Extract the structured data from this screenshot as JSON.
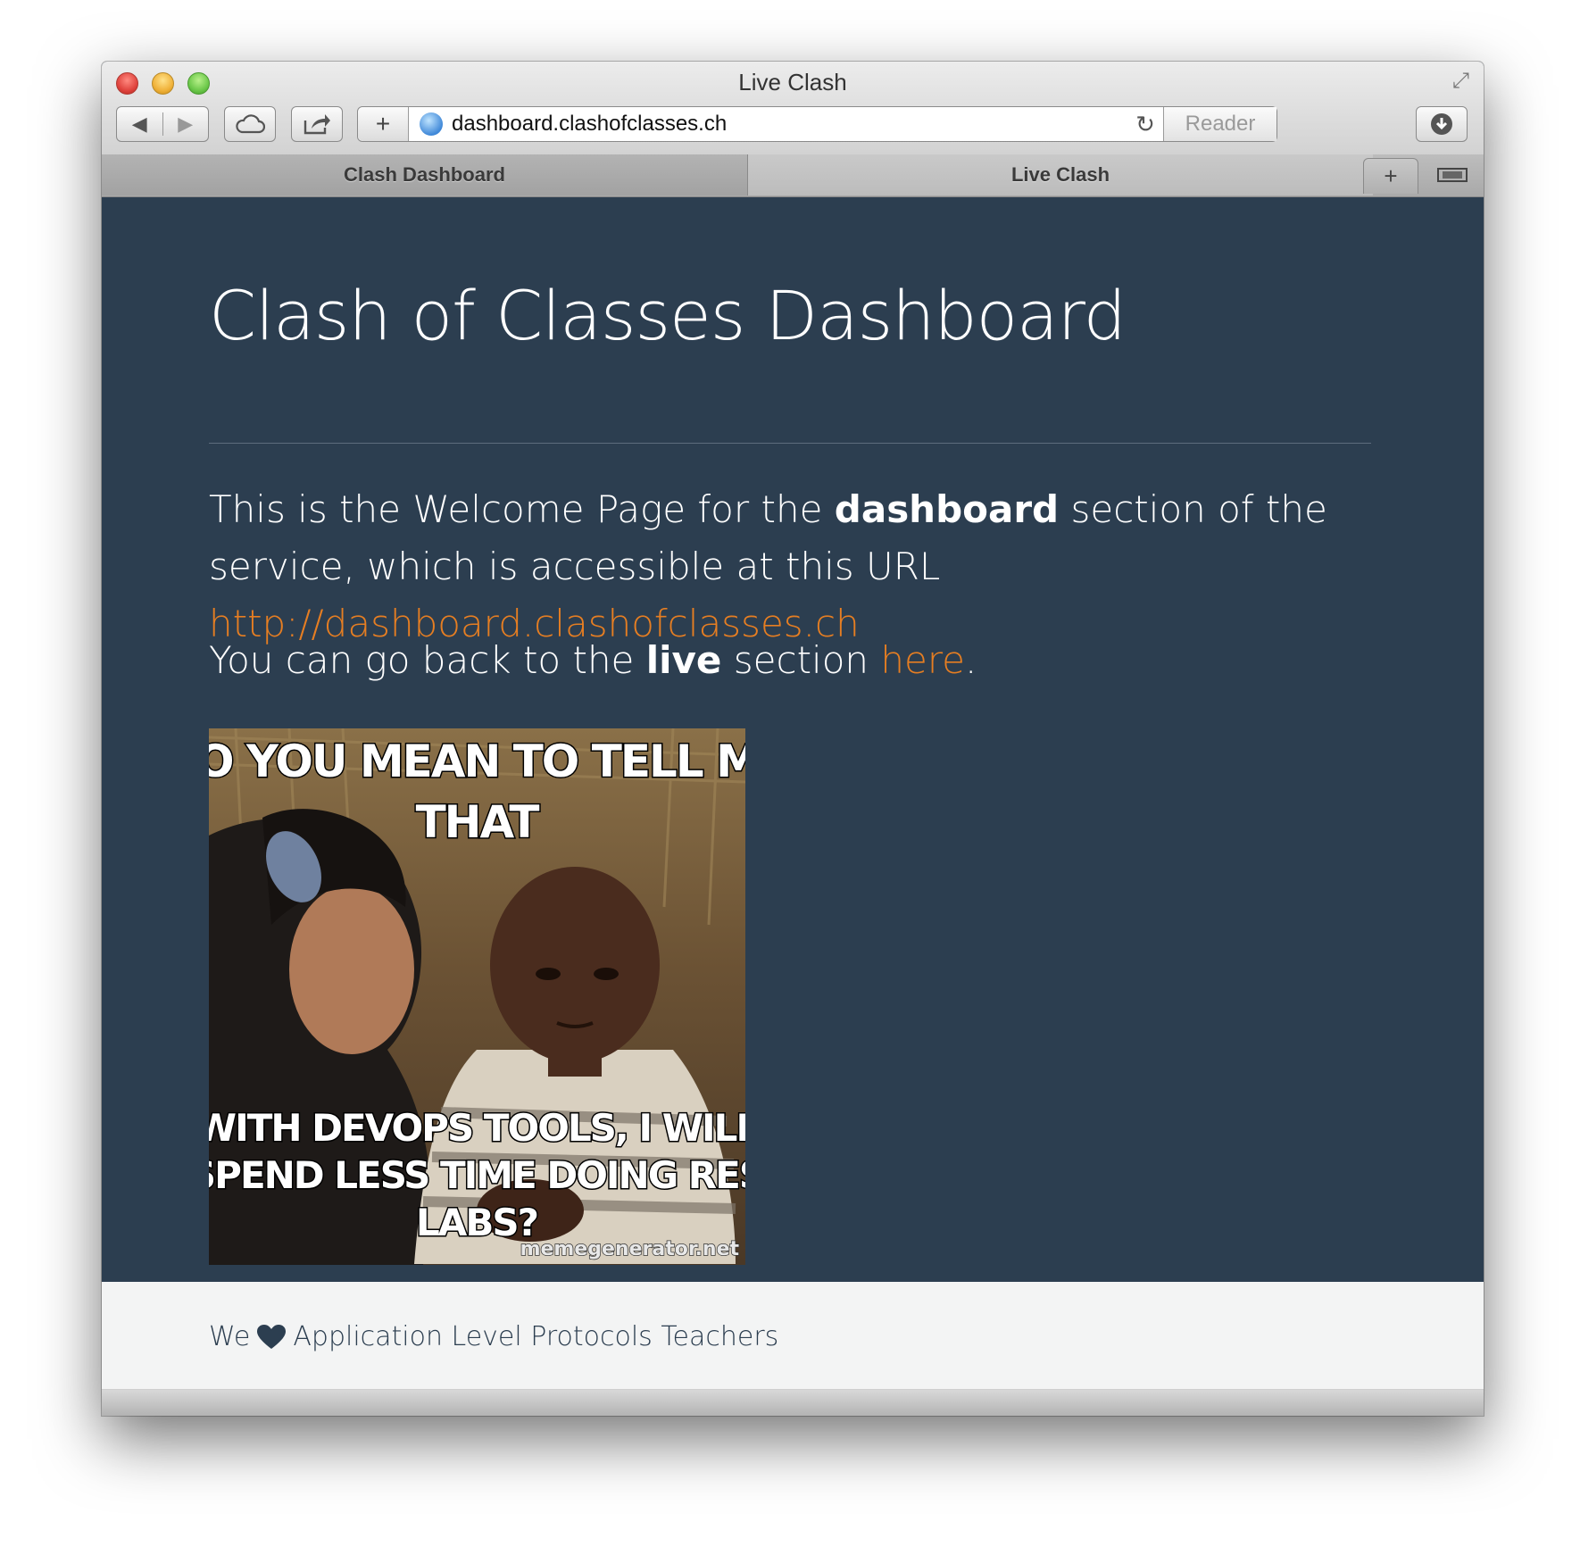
{
  "window": {
    "title": "Live Clash"
  },
  "toolbar": {
    "url": "dashboard.clashofclasses.ch",
    "reader_label": "Reader"
  },
  "tabs": [
    {
      "label": "Clash Dashboard"
    },
    {
      "label": "Live Clash"
    }
  ],
  "page": {
    "heading": "Clash of Classes Dashboard",
    "intro_1": "This is the Welcome Page for the ",
    "intro_bold": "dashboard",
    "intro_2": " section of the service, which is accessible at this URL ",
    "intro_link": "http://dashboard.clashofclasses.ch",
    "back_1": "You can go back to the ",
    "back_bold": "live",
    "back_2": " section ",
    "back_link": "here",
    "back_end": ".",
    "meme": {
      "top_text_1": "SO YOU MEAN TO TELL ME",
      "top_text_2": "THAT",
      "bottom_text_1": "WITH DEVOPS TOOLS, I WILL",
      "bottom_text_2": "SPEND LESS TIME DOING RES",
      "bottom_text_3": "LABS?",
      "watermark": "memegenerator.net"
    }
  },
  "footer": {
    "text_pre": "We",
    "text_post": "Application Level Protocols Teachers"
  },
  "colors": {
    "background": "#2c3e50",
    "link": "#e67e22",
    "footer": "#f3f4f4"
  },
  "icons": [
    "close-icon",
    "minimize-icon",
    "zoom-icon",
    "fullscreen-icon",
    "back-icon",
    "forward-icon",
    "icloud-icon",
    "share-icon",
    "globe-icon",
    "reload-icon",
    "downloads-icon",
    "heart-icon"
  ]
}
